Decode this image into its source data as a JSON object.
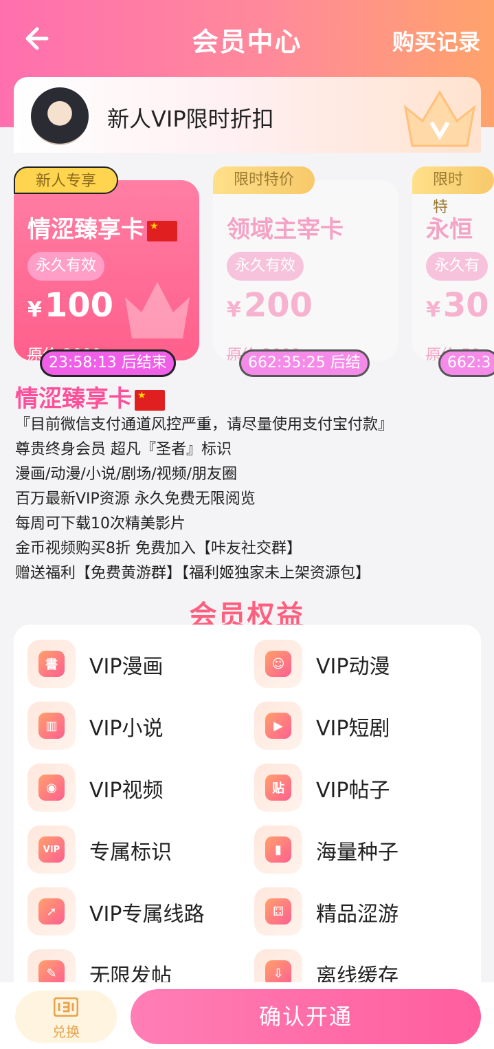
{
  "header": {
    "title": "会员中心",
    "purchase_records": "购买记录"
  },
  "promo": {
    "text": "新人VIP限时折扣"
  },
  "plans": [
    {
      "badge": "新人专享",
      "name": "情涩臻享卡",
      "validity": "永久有效",
      "currency": "¥",
      "price": "100",
      "original": "原价:2000",
      "countdown": "23:58:13 后结束",
      "selected": true
    },
    {
      "badge": "限时特价",
      "name": "领域主宰卡",
      "validity": "永久有效",
      "currency": "¥",
      "price": "200",
      "original": "原价:3000",
      "countdown": "662:35:25 后结",
      "selected": false
    },
    {
      "badge": "限时特",
      "name": "永恒",
      "validity": "永久有",
      "currency": "¥",
      "price": "30",
      "original": "原价:50",
      "countdown": "662:3",
      "selected": false
    }
  ],
  "detail": {
    "title": "情涩臻享卡",
    "lines": [
      "『目前微信支付通道风控严重，请尽量使用支付宝付款』",
      "尊贵终身会员 超凡『圣者』标识",
      "漫画/动漫/小说/剧场/视频/朋友圈",
      "百万最新VIP资源 永久免费无限阅览",
      "每周可下载10次精美影片",
      "金币视频购买8折 免费加入【咔友社交群】",
      "赠送福利【免费黄游群】【福利姬独家未上架资源包】"
    ]
  },
  "benefits": {
    "title": "会员权益",
    "items": [
      {
        "label": "VIP漫画",
        "icon": "book-icon"
      },
      {
        "label": "VIP动漫",
        "icon": "tv-icon"
      },
      {
        "label": "VIP小说",
        "icon": "novel-icon"
      },
      {
        "label": "VIP短剧",
        "icon": "phone-play-icon"
      },
      {
        "label": "VIP视频",
        "icon": "film-reel-icon"
      },
      {
        "label": "VIP帖子",
        "icon": "post-icon"
      },
      {
        "label": "专属标识",
        "icon": "vip-badge-icon"
      },
      {
        "label": "海量种子",
        "icon": "zip-icon"
      },
      {
        "label": "VIP专属线路",
        "icon": "rocket-icon"
      },
      {
        "label": "精品涩游",
        "icon": "gamepad-icon"
      },
      {
        "label": "无限发帖",
        "icon": "edit-icon"
      },
      {
        "label": "离线缓存",
        "icon": "cloud-download-icon"
      }
    ]
  },
  "bottom": {
    "exchange": "兑换",
    "confirm": "确认开通"
  },
  "glyphs": {
    "book-icon": "書",
    "tv-icon": "☺",
    "novel-icon": "▥",
    "phone-play-icon": "▶",
    "film-reel-icon": "◉",
    "post-icon": "贴",
    "vip-badge-icon": "VIP",
    "zip-icon": "▮",
    "rocket-icon": "➚",
    "gamepad-icon": "⚃",
    "edit-icon": "✎",
    "cloud-download-icon": "⇩"
  },
  "colors": {
    "brand_pink": "#ff5e9d",
    "brand_orange": "#ffa36b",
    "countdown": "#f05fe7"
  }
}
